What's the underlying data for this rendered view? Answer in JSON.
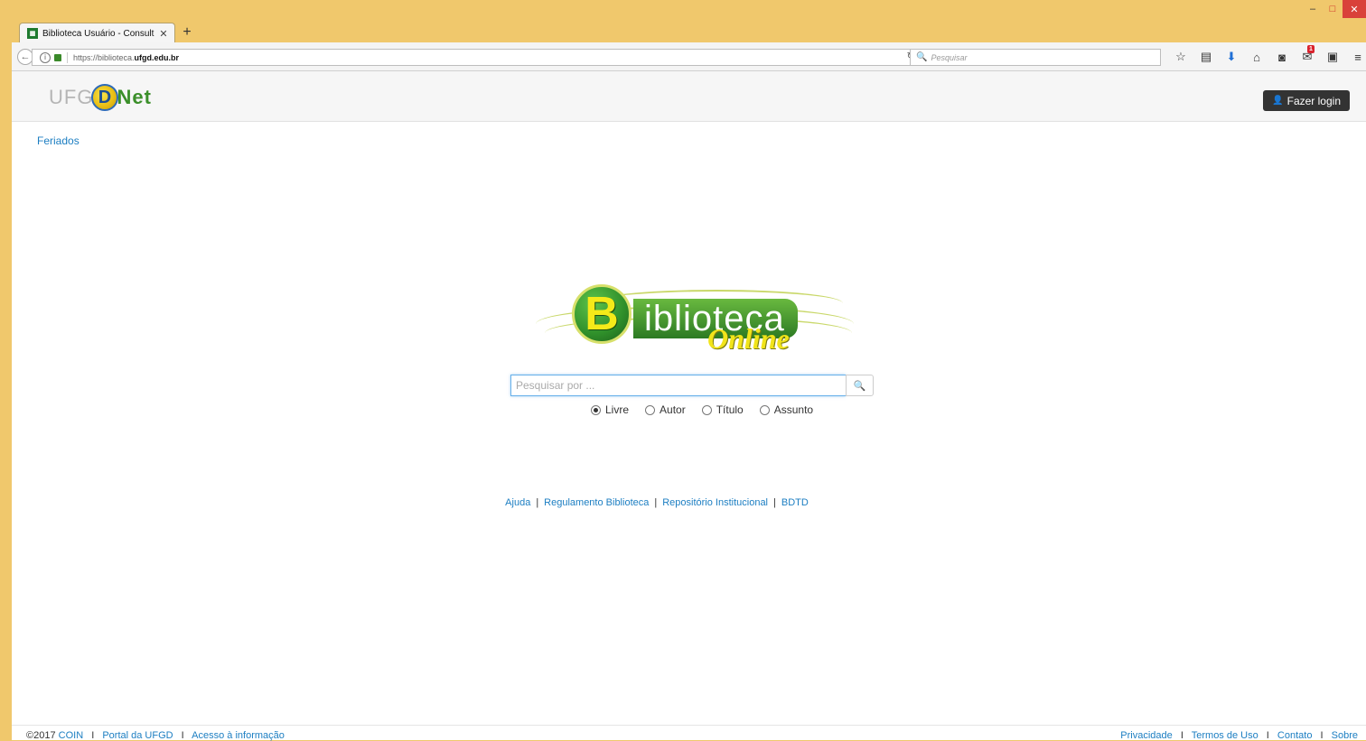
{
  "browser": {
    "tab_title": "Biblioteca Usuário - Consult",
    "tab_close": "✕",
    "new_tab": "+",
    "url_prefix": "https://biblioteca.",
    "url_domain": "ufgd.edu.br",
    "search_placeholder": "Pesquisar",
    "window_min": "–",
    "window_max": "□",
    "window_close": "✕",
    "downloads_badge": "1"
  },
  "header": {
    "logo_uf": "UF",
    "logo_g": "G",
    "logo_d": "D",
    "logo_net": "Net",
    "login_label": "Fazer login"
  },
  "nav": {
    "feriados": "Feriados"
  },
  "logo_main": {
    "b": "B",
    "word": "iblioteca",
    "online": "Online"
  },
  "search": {
    "placeholder": "Pesquisar por ...",
    "options": [
      "Livre",
      "Autor",
      "Título",
      "Assunto"
    ],
    "selected": "Livre"
  },
  "links": [
    "Ajuda",
    "Regulamento Biblioteca",
    "Repositório Institucional",
    "BDTD"
  ],
  "footer": {
    "copyright": "©2017",
    "left_links": [
      "COIN",
      "Portal da UFGD",
      "Acesso à informação"
    ],
    "right_links": [
      "Privacidade",
      "Termos de Uso",
      "Contato",
      "Sobre"
    ],
    "separator": "I"
  },
  "colors": {
    "chrome": "#f0c86c",
    "link": "#1c7ec2",
    "login_bg": "#333333"
  }
}
